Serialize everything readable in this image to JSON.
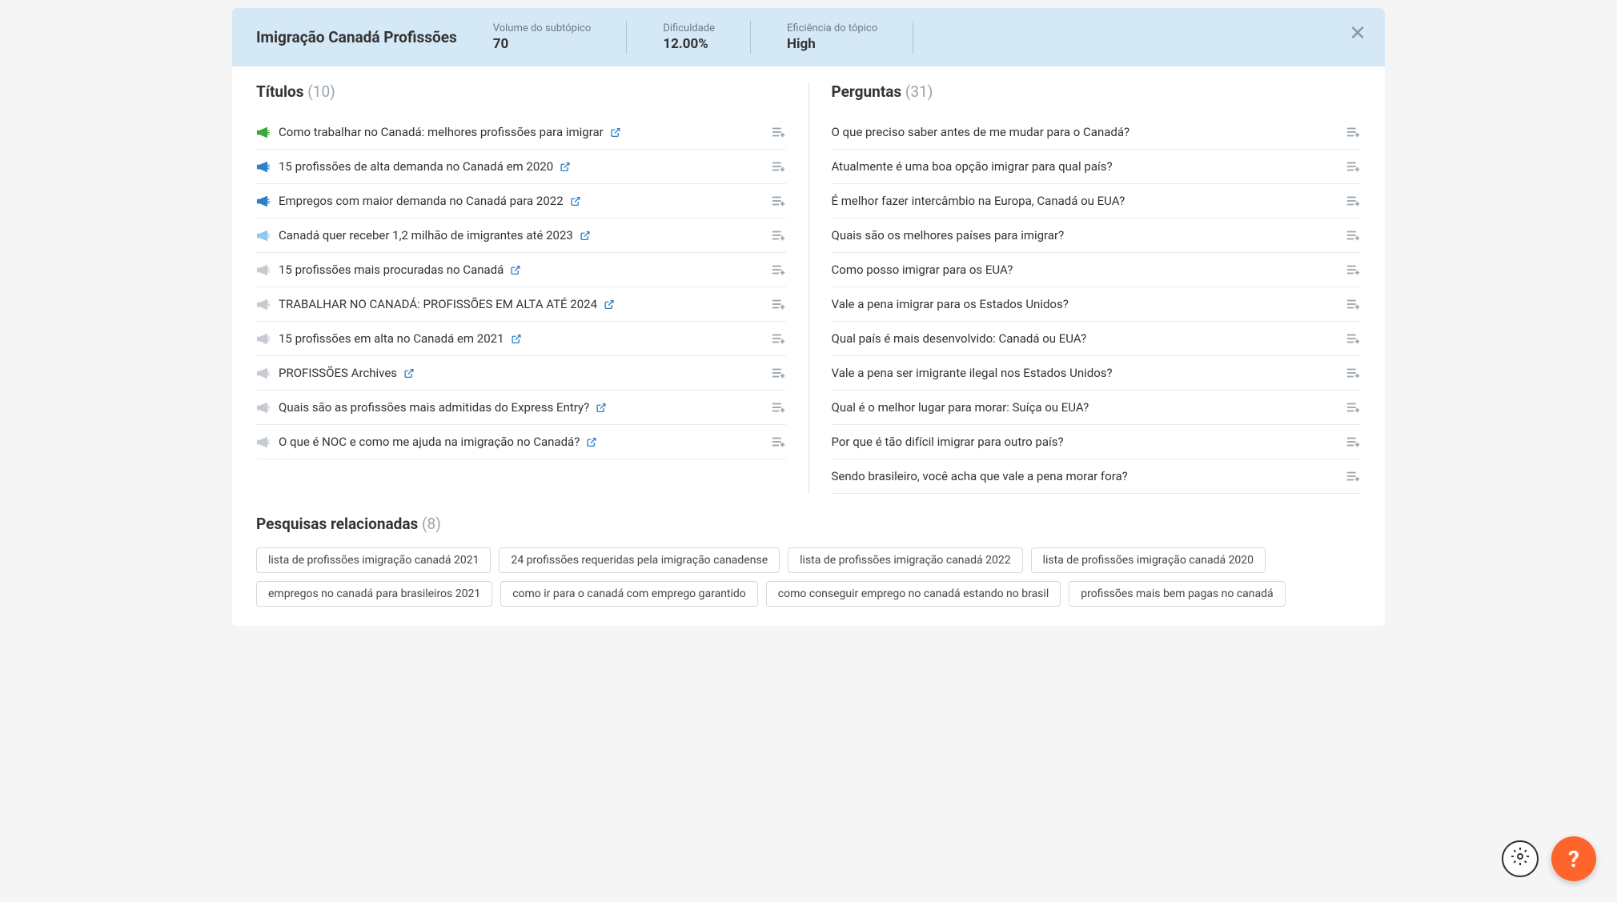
{
  "header": {
    "title": "Imigração Canadá Profissões",
    "stats": {
      "volume": {
        "label": "Volume do subtópico",
        "value": "70"
      },
      "difficulty": {
        "label": "Dificuldade",
        "value": "12.00%"
      },
      "efficiency": {
        "label": "Eficiência do tópico",
        "value": "High"
      }
    }
  },
  "titles": {
    "label": "Títulos",
    "count": "(10)",
    "items": [
      {
        "text": "Como trabalhar no Canadá: melhores profissões para imigrar",
        "color": "#3ba93b"
      },
      {
        "text": "15 profissões de alta demanda no Canadá em 2020",
        "color": "#2e7ec9"
      },
      {
        "text": "Empregos com maior demanda no Canadá para 2022",
        "color": "#2e7ec9"
      },
      {
        "text": "Canadá quer receber 1,2 milhão de imigrantes até 2023",
        "color": "#8ec8ed"
      },
      {
        "text": "15 profissões mais procuradas no Canadá",
        "color": "#c5cbd0"
      },
      {
        "text": "TRABALHAR NO CANADÁ: PROFISSÕES EM ALTA ATÉ 2024",
        "color": "#c5cbd0"
      },
      {
        "text": "15 profissões em alta no Canadá em 2021",
        "color": "#c5cbd0"
      },
      {
        "text": "PROFISSÕES Archives",
        "color": "#c5cbd0"
      },
      {
        "text": "Quais são as profissões mais admitidas do Express Entry?",
        "color": "#c5cbd0"
      },
      {
        "text": "O que é NOC e como me ajuda na imigração no Canadá?",
        "color": "#c5cbd0"
      }
    ]
  },
  "questions": {
    "label": "Perguntas",
    "count": "(31)",
    "items": [
      {
        "text": "O que preciso saber antes de me mudar para o Canadá?"
      },
      {
        "text": "Atualmente é uma boa opção imigrar para qual país?"
      },
      {
        "text": "É melhor fazer intercâmbio na Europa, Canadá ou EUA?"
      },
      {
        "text": "Quais são os melhores países para imigrar?"
      },
      {
        "text": "Como posso imigrar para os EUA?"
      },
      {
        "text": "Vale a pena imigrar para os Estados Unidos?"
      },
      {
        "text": "Qual país é mais desenvolvido: Canadá ou EUA?"
      },
      {
        "text": "Vale a pena ser imigrante ilegal nos Estados Unidos?"
      },
      {
        "text": "Qual é o melhor lugar para morar: Suíça ou EUA?"
      },
      {
        "text": "Por que é tão difícil imigrar para outro país?"
      },
      {
        "text": "Sendo brasileiro, você acha que vale a pena morar fora?"
      }
    ]
  },
  "related": {
    "label": "Pesquisas relacionadas",
    "count": "(8)",
    "chips": [
      "lista de profissões imigração canadá 2021",
      "24 profissões requeridas pela imigração canadense",
      "lista de profissões imigração canadá 2022",
      "lista de profissões imigração canadá 2020",
      "empregos no canadá para brasileiros 2021",
      "como ir para o canadá com emprego garantido",
      "como conseguir emprego no canadá estando no brasil",
      "profissões mais bem pagas no canadá"
    ]
  }
}
